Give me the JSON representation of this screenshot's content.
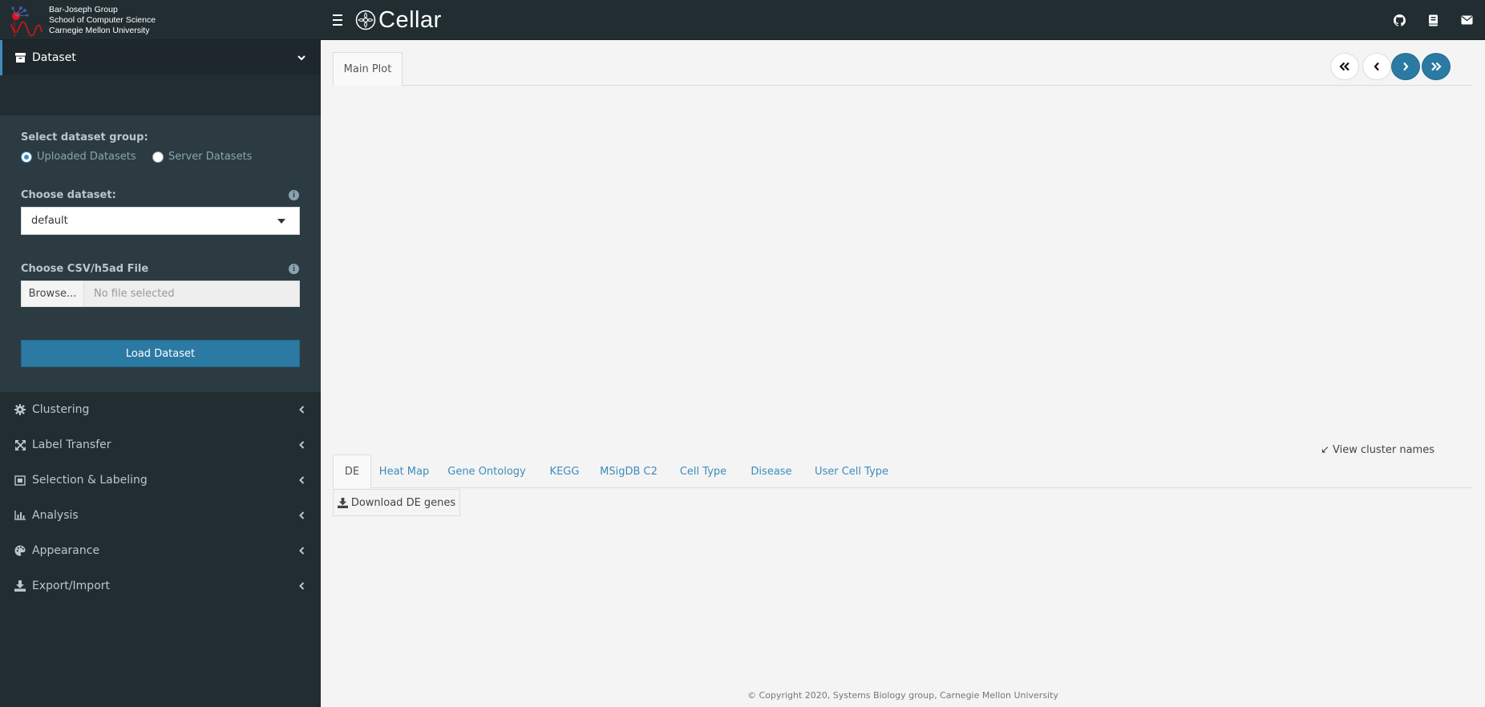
{
  "brand": {
    "line1": "Bar-Joseph Group",
    "line2": "School of Computer Science",
    "line3": "Carnegie Mellon University"
  },
  "header": {
    "app_title": "Cellar",
    "icons": [
      "menu-icon",
      "github-icon",
      "book-icon",
      "envelope-icon"
    ]
  },
  "sidebar": {
    "items": [
      {
        "label": "Dataset",
        "icon": "archive-icon",
        "expanded": true
      },
      {
        "label": "Clustering",
        "icon": "gear-icon"
      },
      {
        "label": "Label Transfer",
        "icon": "expand-arrows-icon"
      },
      {
        "label": "Selection & Labeling",
        "icon": "object-select-icon"
      },
      {
        "label": "Analysis",
        "icon": "bar-chart-icon"
      },
      {
        "label": "Appearance",
        "icon": "palette-icon"
      },
      {
        "label": "Export/Import",
        "icon": "download-icon"
      }
    ],
    "dataset": {
      "group_label": "Select dataset group:",
      "radio_uploaded": "Uploaded Datasets",
      "radio_server": "Server Datasets",
      "selected_group": "Uploaded Datasets",
      "choose_label": "Choose dataset:",
      "selected_dataset": "default",
      "file_label": "Choose CSV/h5ad File",
      "browse_label": "Browse...",
      "file_placeholder": "No file selected",
      "load_label": "Load Dataset"
    }
  },
  "main": {
    "top_tab": "Main Plot",
    "view_cluster_names": "↙ View cluster names",
    "bottom_tabs": [
      "DE",
      "Heat Map",
      "Gene Ontology",
      "KEGG",
      "MSigDB C2",
      "Cell Type",
      "Disease",
      "User Cell Type"
    ],
    "active_bottom_tab": "DE",
    "download_label": "Download DE genes",
    "footer": "© Copyright 2020, Systems Biology group, Carnegie Mellon University"
  },
  "colors": {
    "header_bg": "#222d32",
    "sidebar_bg": "#222d32",
    "panel_bg": "#2c3b41",
    "accent": "#2a7aa3",
    "link": "#3c8dbc",
    "content_bg": "#f4f4f4"
  }
}
